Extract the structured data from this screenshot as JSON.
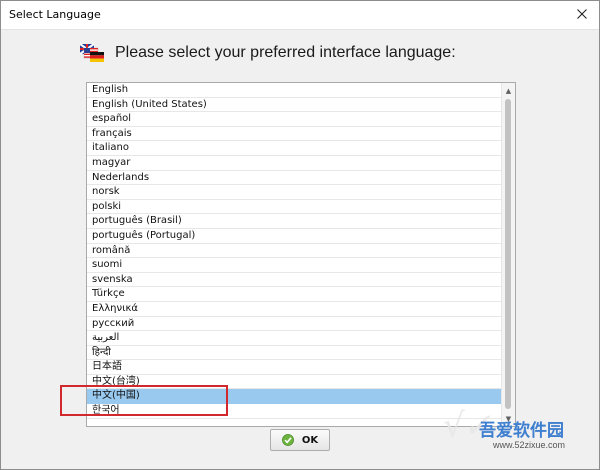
{
  "window": {
    "title": "Select Language"
  },
  "header": {
    "text": "Please select your preferred interface language:"
  },
  "languages": [
    "English",
    "English (United States)",
    "español",
    "français",
    "italiano",
    "magyar",
    "Nederlands",
    "norsk",
    "polski",
    "português (Brasil)",
    "português (Portugal)",
    "română",
    "suomi",
    "svenska",
    "Türkçe",
    "Ελληνικά",
    "русский",
    "العربية",
    "हिन्दी",
    "日本語",
    "中文(台湾)",
    "中文(中国)",
    "한국어"
  ],
  "selected_language": "中文(中国)",
  "ok_button": {
    "label": "OK"
  },
  "watermark": {
    "site_name": "吾爱软件园",
    "url": "www.52zixue.com"
  },
  "colors": {
    "selection": "#99c9ef",
    "highlight_box": "#d0282d"
  }
}
